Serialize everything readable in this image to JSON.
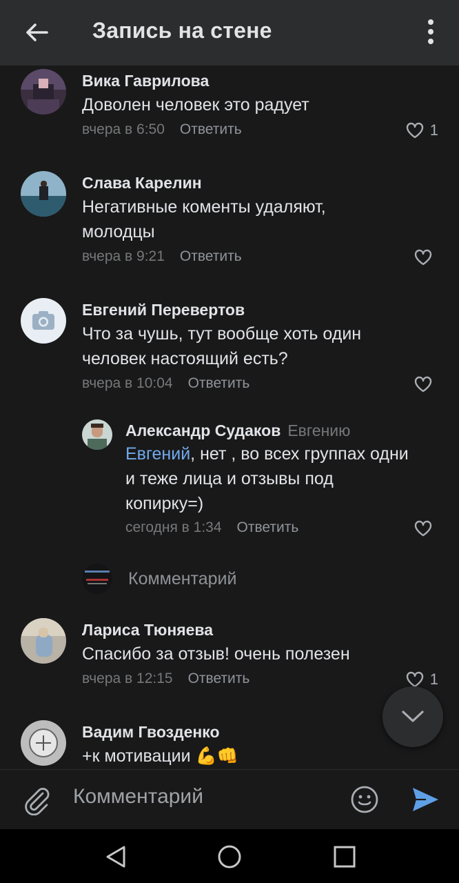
{
  "header": {
    "title": "Запись на стене"
  },
  "comments": [
    {
      "author": "Вика Гаврилова",
      "text": "Доволен человек это радует",
      "time": "вчера в 6:50",
      "reply": "Ответить",
      "likes": "1"
    },
    {
      "author": "Слава Карелин",
      "text": "Негативные коменты удаляют, молодцы",
      "time": "вчера в 9:21",
      "reply": "Ответить",
      "likes": ""
    },
    {
      "author": "Евгений Перевертов",
      "text": "Что за чушь, тут вообще хоть один человек настоящий есть?",
      "time": "вчера в 10:04",
      "reply": "Ответить",
      "likes": ""
    },
    {
      "author": "Александр Судаков",
      "reply_to": "Евгению",
      "mention": "Евгений",
      "text": ", нет , во всех группах одни и теже лица и отзывы под копирку=)",
      "time": "сегодня в 1:34",
      "reply": "Ответить",
      "likes": ""
    },
    {
      "author": "Лариса Тюняева",
      "text": "Спасибо за отзыв! очень полезен",
      "time": "вчера в 12:15",
      "reply": "Ответить",
      "likes": "1"
    },
    {
      "author": "Вадим Гвозденко",
      "text": "+к мотивации 💪👊"
    }
  ],
  "inline_reply": {
    "placeholder": "Комментарий"
  },
  "composer": {
    "placeholder": "Комментарий"
  },
  "colors": {
    "background": "#19191a",
    "header": "#2c2d2e",
    "accent": "#71aaeb",
    "send": "#5f9fe6",
    "secondary_text": "#76787a"
  },
  "icons": [
    "back-arrow-icon",
    "more-vertical-icon",
    "heart-icon",
    "chevron-down-icon",
    "paperclip-icon",
    "emoji-icon",
    "send-icon",
    "nav-back-icon",
    "nav-home-icon",
    "nav-recents-icon"
  ]
}
